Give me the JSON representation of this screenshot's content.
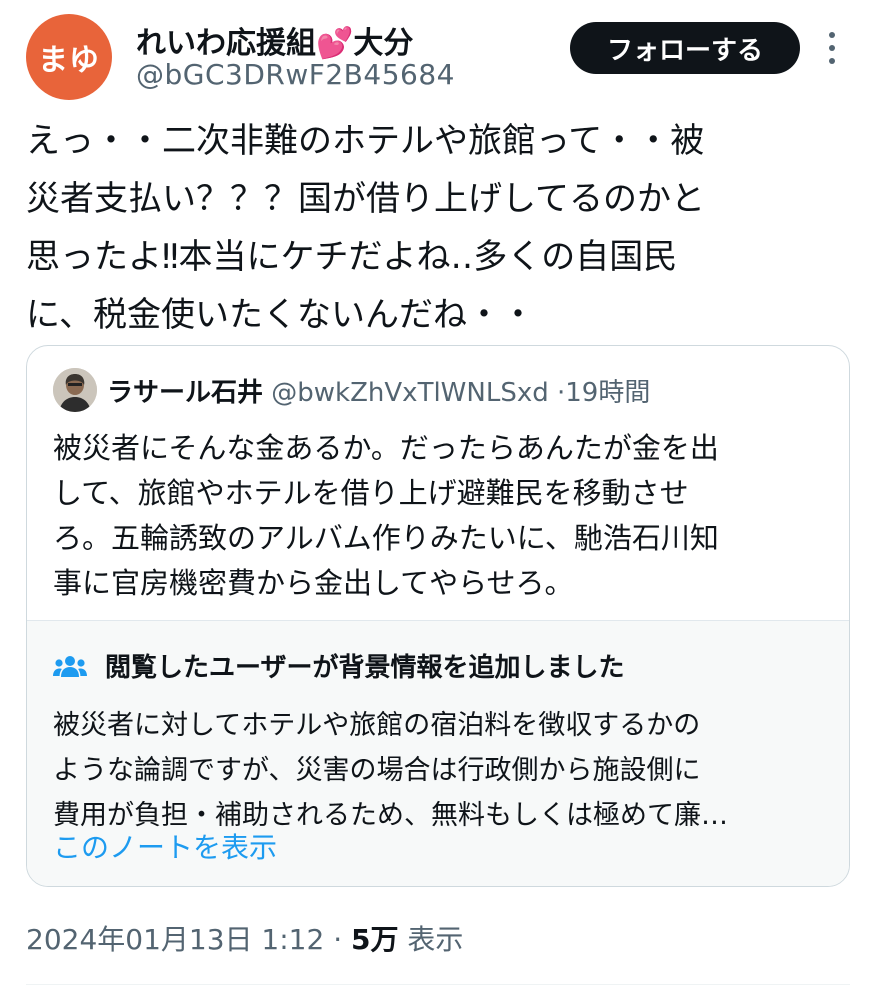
{
  "author": {
    "avatar_text": "まゆ",
    "display_name": "れいわ応援組💕大分",
    "handle": "@bGC3DRwF2B45684"
  },
  "actions": {
    "follow_label": "フォローする",
    "more_icon": "more-vertical-icon"
  },
  "tweet": {
    "text": "えっ・・二次非難のホテルや旅館って・・被\n災者支払い？？？国が借り上げしてるのかと\n思ったよ‼︎本当にケチだよね‥多くの自国民\nに、税金使いたくないんだね・・"
  },
  "quote": {
    "author_name": "ラサール石井",
    "author_handle": "@bwkZhVxTlWNLSxd",
    "separator": "·",
    "time": "19時間",
    "text": "被災者にそんな金あるか。だったらあんたが金を出\nして、旅館やホテルを借り上げ避難民を移動させ\nろ。五輪誘致のアルバム作りみたいに、馳浩石川知\n事に官房機密費から金出してやらせろ。"
  },
  "community_note": {
    "icon": "people-icon",
    "title": "閲覧したユーザーが背景情報を追加しました",
    "text": "被災者に対してホテルや旅館の宿泊料を徴収するかの\nような論調ですが、災害の場合は行政側から施設側に\n費用が負担・補助されるため、無料もしくは極めて廉…",
    "link_label": "このノートを表示",
    "link_color": "#1d9bf0"
  },
  "meta": {
    "timestamp": "2024年01月13日 1:12",
    "separator": "·",
    "views_count": "5万",
    "views_label": "表示"
  },
  "colors": {
    "avatar_bg": "#e8643a",
    "button_bg": "#0f1419",
    "secondary_text": "#536471"
  }
}
